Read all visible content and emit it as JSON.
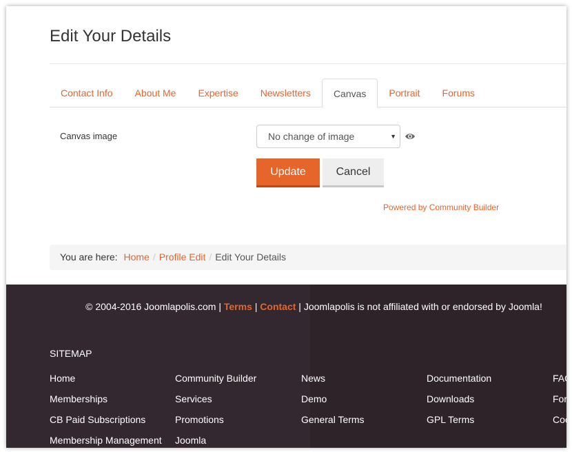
{
  "page": {
    "title": "Edit Your Details"
  },
  "tabs": [
    {
      "label": "Contact Info",
      "active": false
    },
    {
      "label": "About Me",
      "active": false
    },
    {
      "label": "Expertise",
      "active": false
    },
    {
      "label": "Newsletters",
      "active": false
    },
    {
      "label": "Canvas",
      "active": true
    },
    {
      "label": "Portrait",
      "active": false
    },
    {
      "label": "Forums",
      "active": false
    }
  ],
  "form": {
    "canvas_label": "Canvas image",
    "canvas_select_value": "No change of image",
    "update_label": "Update",
    "cancel_label": "Cancel",
    "powered_by": "Powered by Community Builder"
  },
  "breadcrumb": {
    "prefix": "You are here:",
    "items": [
      "Home",
      "Profile Edit"
    ],
    "current": "Edit Your Details"
  },
  "footer": {
    "copyright_prefix": "© 2004-2016 Joomlapolis.com |",
    "terms": "Terms",
    "sep": "|",
    "contact": "Contact",
    "copyright_suffix": "| Joomlapolis is not affiliated with or endorsed by Joomla!",
    "sitemap_title": "SITEMAP",
    "columns": [
      [
        "Home",
        "Memberships",
        "CB Paid Subscriptions",
        "Membership Management"
      ],
      [
        "Community Builder",
        "Services",
        "Promotions",
        "Joomla"
      ],
      [
        "News",
        "Demo",
        "General Terms"
      ],
      [
        "Documentation",
        "Downloads",
        "GPL Terms"
      ],
      [
        "FAQ",
        "For",
        "Coo"
      ]
    ]
  },
  "colors": {
    "accent": "#e5652a",
    "footer_bg": "#2d2329",
    "breadcrumb_bg": "#f5f5f5"
  },
  "icons": {
    "preview": "eye-icon",
    "select_caret": "caret-down-icon"
  }
}
